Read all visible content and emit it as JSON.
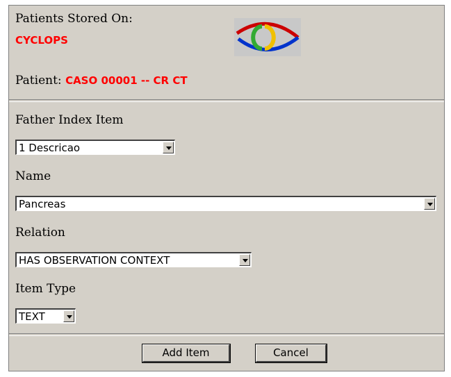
{
  "header": {
    "stored_on_label": "Patients Stored On:",
    "server_name": "CYCLOPS",
    "patient_label": "Patient:",
    "patient_value": "CASO 00001 -- CR CT",
    "logo": {
      "icon": "cyclops-eye-logo",
      "colors": [
        "#cc0000",
        "#0033cc",
        "#33aa33",
        "#f0c000"
      ]
    }
  },
  "form": {
    "father_index": {
      "label": "Father Index Item",
      "value": "1 Descricao"
    },
    "name": {
      "label": "Name",
      "value": "Pancreas"
    },
    "relation": {
      "label": "Relation",
      "value": "HAS OBSERVATION CONTEXT"
    },
    "item_type": {
      "label": "Item Type",
      "value": "TEXT"
    }
  },
  "actions": {
    "add_label": "Add Item",
    "cancel_label": "Cancel"
  }
}
